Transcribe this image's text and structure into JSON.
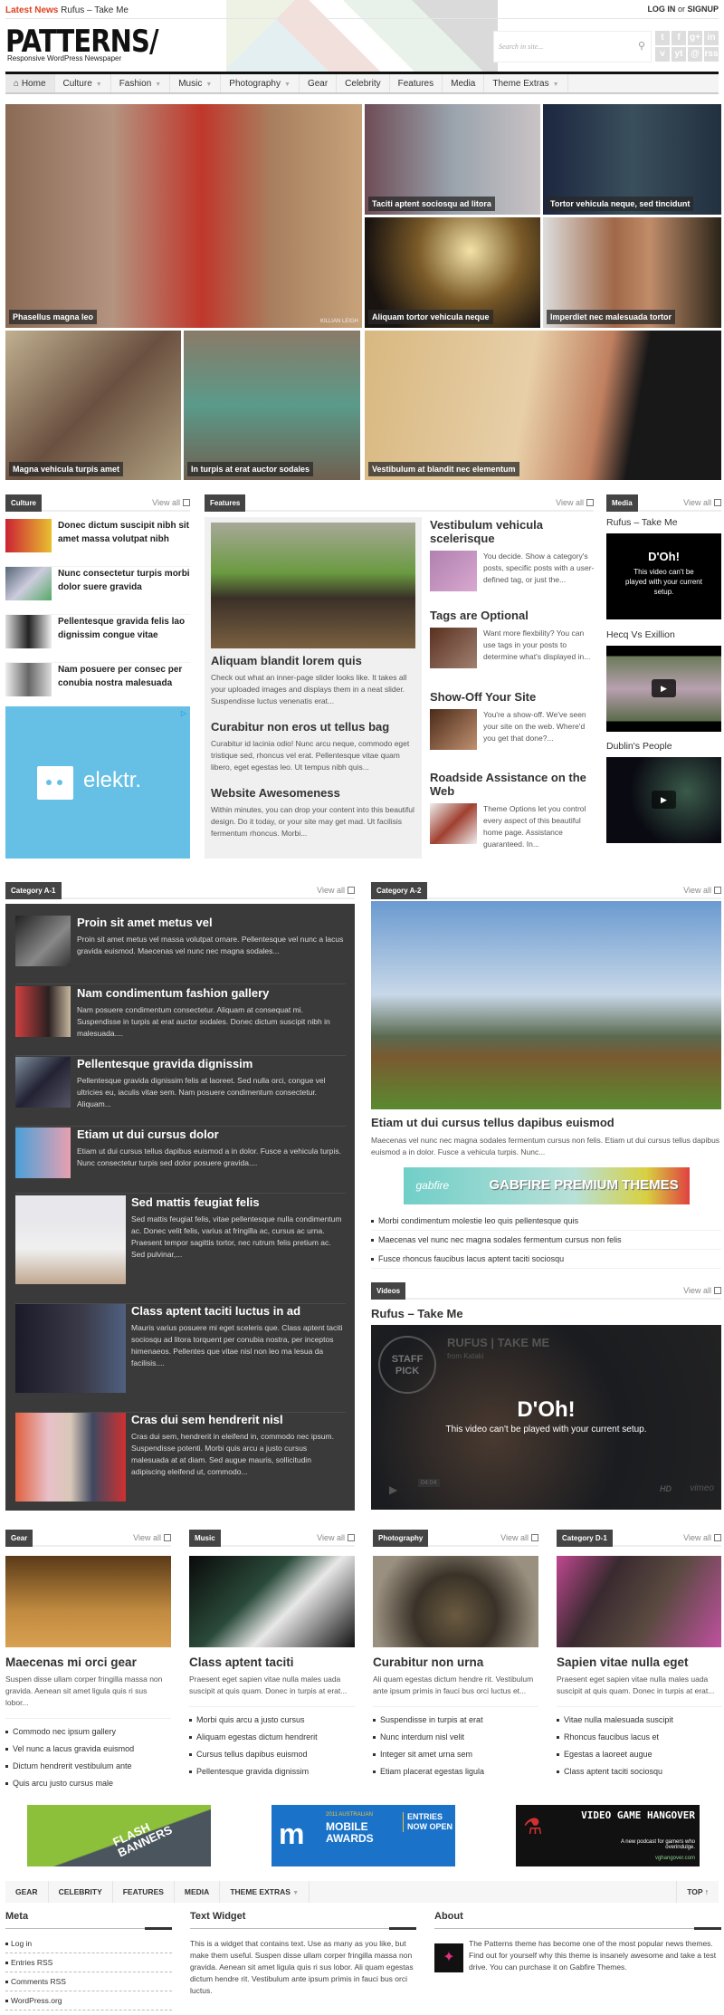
{
  "topbar": {
    "latest_label": "Latest News",
    "latest_item": "Rufus – Take Me",
    "login": "LOG IN",
    "or": "or",
    "signup": "SIGNUP"
  },
  "header": {
    "logo": "PATTERNS/",
    "tagline": "Responsive WordPress Newspaper",
    "search_placeholder": "Search in site...",
    "social": [
      "t",
      "f",
      "g+",
      "in",
      "v",
      "yt",
      "@",
      "rss"
    ]
  },
  "nav": [
    {
      "label": "Home",
      "icon": "home-icon"
    },
    {
      "label": "Culture",
      "caret": true
    },
    {
      "label": "Fashion",
      "caret": true
    },
    {
      "label": "Music",
      "caret": true
    },
    {
      "label": "Photography",
      "caret": true
    },
    {
      "label": "Gear"
    },
    {
      "label": "Celebrity"
    },
    {
      "label": "Features"
    },
    {
      "label": "Media"
    },
    {
      "label": "Theme Extras",
      "caret": true
    }
  ],
  "mosaic": [
    "Phasellus magna leo",
    "Taciti aptent sociosqu ad litora",
    "Tortor vehicula neque, sed tincidunt",
    "Aliquam tortor vehicula neque",
    "Imperdiet nec malesuada tortor",
    "Magna vehicula turpis amet",
    "In turpis at erat auctor sodales",
    "Vestibulum at blandit nec elementum"
  ],
  "mosaic_credit": "KILLIAN LEIGH",
  "view_all": "View all",
  "culture": {
    "label": "Culture",
    "items": [
      "Donec dictum suscipit nibh sit amet massa volutpat nibh",
      "Nunc consectetur turpis morbi dolor suere gravida",
      "Pellentesque gravida felis lao dignissim congue vitae",
      "Nam posuere per consec per conubia nostra malesuada"
    ],
    "ad": "elektr."
  },
  "features": {
    "label": "Features",
    "posts": [
      {
        "title": "Aliquam blandit lorem quis",
        "excerpt": "Check out what an inner-page slider looks like. It takes all your uploaded images and displays them in a neat slider. Suspendisse luctus venenatis erat..."
      },
      {
        "title": "Curabitur non eros ut tellus bag",
        "excerpt": "Curabitur id lacinia odio! Nunc arcu neque, commodo eget tristique sed, rhoncus vel erat. Pellentesque vitae quam libero, eget egestas leo. Ut tempus nibh quis..."
      },
      {
        "title": "Website Awesomeness",
        "excerpt": "Within minutes, you can drop your content into this beautiful design. Do it today, or your site may get mad. Ut facilisis fermentum rhoncus. Morbi..."
      }
    ],
    "side": [
      {
        "title": "Vestibulum vehicula scelerisque",
        "excerpt": "You decide. Show a category's posts, specific posts with a user-defined tag, or just the..."
      },
      {
        "title": "Tags are Optional",
        "excerpt": "Want more flexbility? You can use tags in your posts to determine what's displayed in..."
      },
      {
        "title": "Show-Off Your Site",
        "excerpt": "You're a show-off. We've seen your site on the web. Where'd you get that done?..."
      },
      {
        "title": "Roadside Assistance on the Web",
        "excerpt": "Theme Options let you control every aspect of this beautiful home page. Assistance guaranteed. In..."
      }
    ]
  },
  "media": {
    "label": "Media",
    "videos": [
      {
        "title": "Rufus – Take Me",
        "error_title": "D'Oh!",
        "error_text": "This video can't be played with your current setup."
      },
      {
        "title": "Hecq Vs Exillion"
      },
      {
        "title": "Dublin's People"
      }
    ]
  },
  "cat_a1": {
    "label": "Category A-1",
    "posts": [
      {
        "title": "Proin sit amet metus vel",
        "excerpt": "Proin sit amet metus vel massa volutpat ornare. Pellentesque vel nunc a lacus gravida euismod. Maecenas vel nunc nec magna sodales..."
      },
      {
        "title": "Nam condimentum fashion gallery",
        "excerpt": "Nam posuere condimentum consectetur. Aliquam at consequat mi. Suspendisse in turpis at erat auctor sodales. Donec dictum suscipit nibh in malesuada...."
      },
      {
        "title": "Pellentesque gravida dignissim",
        "excerpt": "Pellentesque gravida dignissim felis at laoreet. Sed nulla orci, congue vel ultricies eu, iaculis vitae sem. Nam posuere condimentum consectetur. Aliquam..."
      },
      {
        "title": "Etiam ut dui cursus dolor",
        "excerpt": "Etiam ut dui cursus tellus dapibus euismod a in dolor. Fusce a vehicula turpis. Nunc consectetur turpis sed dolor posuere gravida...."
      },
      {
        "title": "Sed mattis feugiat felis",
        "excerpt": "Sed mattis feugiat felis, vitae pellentesque nulla condimentum ac. Donec velit felis, varius at fringilla ac, cursus ac urna. Praesent tempor sagittis tortor, nec rutrum felis pretium ac. Sed pulvinar,..."
      },
      {
        "title": "Class aptent taciti luctus in ad",
        "excerpt": "Mauris varius posuere mi eget sceleris que. Class aptent taciti sociosqu ad litora torquent per conubia nostra, per inceptos himenaeos. Pellentes que vitae nisl non leo ma lesua da facilisis...."
      },
      {
        "title": "Cras dui sem hendrerit nisl",
        "excerpt": "Cras dui sem, hendrerit in eleifend in, commodo nec ipsum. Suspendisse potenti. Morbi quis arcu a justo cursus malesuada at at diam. Sed augue mauris, sollicitudin adipiscing eleifend ut, commodo..."
      }
    ]
  },
  "cat_a2": {
    "label": "Category A-2",
    "title": "Etiam ut dui cursus tellus dapibus euismod",
    "excerpt": "Maecenas vel nunc nec magna sodales fermentum cursus non felis. Etiam ut dui cursus tellus dapibus euismod a in dolor. Fusce a vehicula turpis. Nunc...",
    "ad_brand": "gabfire",
    "ad_text": "GABFIRE PREMIUM THEMES",
    "links": [
      "Morbi condimentum molestie leo quis pellentesque quis",
      "Maecenas vel nunc nec magna sodales fermentum cursus non felis",
      "Fusce rhoncus faucibus lacus aptent taciti sociosqu"
    ]
  },
  "videos": {
    "label": "Videos",
    "title": "Rufus – Take Me",
    "player_title": "RUFUS | TAKE ME",
    "player_from": "from Kataki",
    "badge": "STAFF PICK",
    "error_title": "D'Oh!",
    "error_text": "This video can't be played with your current setup.",
    "time": "04:04",
    "brand": "vimeo",
    "hd": "HD"
  },
  "columns": [
    {
      "label": "Gear",
      "title": "Maecenas mi orci gear",
      "excerpt": "Suspen disse ullam corper fringilla massa non gravida. Aenean sit amet ligula quis ri sus lobor...",
      "links": [
        "Commodo nec ipsum gallery",
        "Vel nunc a lacus gravida euismod",
        "Dictum hendrerit vestibulum ante",
        "Quis arcu justo cursus male"
      ]
    },
    {
      "label": "Music",
      "title": "Class aptent taciti",
      "excerpt": "Praesent eget sapien vitae nulla males uada suscipit at quis quam. Donec in turpis at erat...",
      "links": [
        "Morbi quis arcu a justo cursus",
        "Aliquam egestas dictum hendrerit",
        "Cursus tellus dapibus euismod",
        "Pellentesque gravida dignissim"
      ]
    },
    {
      "label": "Photography",
      "title": "Curabitur non urna",
      "excerpt": "Ali quam egestas dictum hendre rit. Vestibulum ante ipsum primis in fauci bus orci luctus et...",
      "links": [
        "Suspendisse in turpis at erat",
        "Nunc interdum nisl velit",
        "Integer sit amet urna sem",
        "Etiam placerat egestas ligula"
      ]
    },
    {
      "label": "Category D-1",
      "title": "Sapien vitae nulla eget",
      "excerpt": "Praesent eget sapien vitae nulla males uada suscipit at quis quam. Donec in turpis at erat...",
      "links": [
        "Vitae nulla malesuada suscipit",
        "Rhoncus faucibus lacus et",
        "Egestas a laoreet augue",
        "Class aptent taciti sociosqu"
      ]
    }
  ],
  "ads": [
    {
      "text": "FLASH BANNERS",
      "color": "#8cbf3a"
    },
    {
      "line1": "2011 AUSTRALIAN",
      "line2": "MOBILE AWARDS",
      "line3": "ENTRIES NOW OPEN",
      "color": "#1a73c9"
    },
    {
      "line1": "VIDEO GAME HANGOVER",
      "line2": "A new podcast for gamers who overindulge.",
      "line3": "vghangover.com",
      "color": "#111111"
    }
  ],
  "footer_nav": [
    "GEAR",
    "CELEBRITY",
    "FEATURES",
    "MEDIA",
    "THEME EXTRAS"
  ],
  "footer_top": "TOP ↑",
  "footer": {
    "meta": {
      "title": "Meta",
      "links": [
        "Log in",
        "Entries RSS",
        "Comments RSS",
        "WordPress.org"
      ]
    },
    "text_widget": {
      "title": "Text Widget",
      "body": "This is a widget that contains text. Use as many as you like, but make them useful. Suspen disse ullam corper fringilla massa non gravida. Aenean sit amet ligula quis ri sus lobor. Ali quam egestas dictum hendre rit. Vestibulum ante ipsum primis in fauci bus orci luctus."
    },
    "about": {
      "title": "About",
      "body": "The Patterns theme has become one of the most popular news themes. Find out for yourself why this theme is insanely awesome and take a test drive. You can purchase it on Gabfire Themes."
    }
  },
  "colors": {
    "accent": "#e0411c",
    "dark_box": "#3a3a3a",
    "label_bg": "#444444",
    "ad_blue": "#66c0e6"
  }
}
